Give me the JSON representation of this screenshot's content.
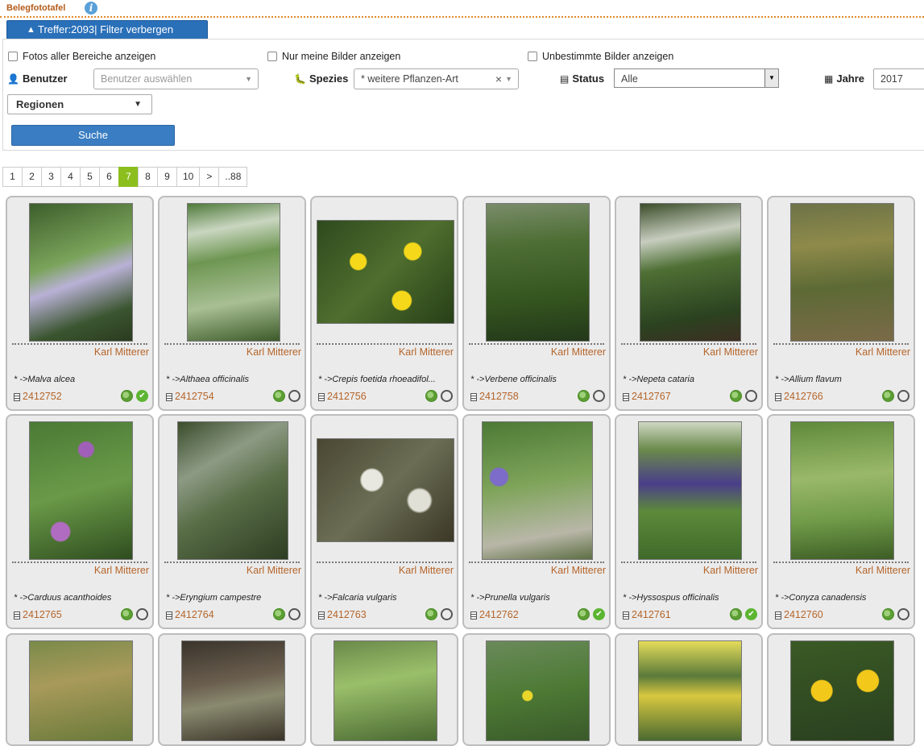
{
  "header": {
    "title": "Belegfototafel",
    "info_icon": "info-icon"
  },
  "filter_toggle": {
    "label": "Treffer:2093| Filter verbergen"
  },
  "filters": {
    "checkbox_all_areas": "Fotos aller Bereiche anzeigen",
    "checkbox_my_images": "Nur meine Bilder anzeigen",
    "checkbox_undetermined": "Unbestimmte Bilder anzeigen",
    "user_label": "Benutzer",
    "user_placeholder": "Benutzer auswählen",
    "species_label": "Spezies",
    "species_value": "* weitere Pflanzen-Art",
    "status_label": "Status",
    "status_value": "Alle",
    "year_label": "Jahre",
    "year_value": "2017",
    "regions_label": "Regionen",
    "search_button": "Suche"
  },
  "pager": {
    "pages": [
      "1",
      "2",
      "3",
      "4",
      "5",
      "6",
      "7",
      "8",
      "9",
      "10",
      ">",
      "..88"
    ],
    "active": "7"
  },
  "cards": [
    {
      "author": "Karl Mitterer",
      "species": "* ->Malva alcea",
      "id": "2412752",
      "verified": true
    },
    {
      "author": "Karl Mitterer",
      "species": "* ->Althaea officinalis",
      "id": "2412754",
      "verified": false
    },
    {
      "author": "Karl Mitterer",
      "species": "* ->Crepis foetida rhoeadifol...",
      "id": "2412756",
      "verified": false
    },
    {
      "author": "Karl Mitterer",
      "species": "* ->Verbene officinalis",
      "id": "2412758",
      "verified": false
    },
    {
      "author": "Karl Mitterer",
      "species": "* ->Nepeta cataria",
      "id": "2412767",
      "verified": false
    },
    {
      "author": "Karl Mitterer",
      "species": "* ->Allium flavum",
      "id": "2412766",
      "verified": false
    },
    {
      "author": "Karl Mitterer",
      "species": "* ->Carduus acanthoides",
      "id": "2412765",
      "verified": false
    },
    {
      "author": "Karl Mitterer",
      "species": "* ->Eryngium campestre",
      "id": "2412764",
      "verified": false
    },
    {
      "author": "Karl Mitterer",
      "species": "* ->Falcaria vulgaris",
      "id": "2412763",
      "verified": false
    },
    {
      "author": "Karl Mitterer",
      "species": "* ->Prunella vulgaris",
      "id": "2412762",
      "verified": true
    },
    {
      "author": "Karl Mitterer",
      "species": "* ->Hyssospus officinalis",
      "id": "2412761",
      "verified": true
    },
    {
      "author": "Karl Mitterer",
      "species": "* ->Conyza canadensis",
      "id": "2412760",
      "verified": false
    },
    {
      "author": "",
      "species": "",
      "id": "",
      "verified": false
    },
    {
      "author": "",
      "species": "",
      "id": "",
      "verified": false
    },
    {
      "author": "",
      "species": "",
      "id": "",
      "verified": false
    },
    {
      "author": "",
      "species": "",
      "id": "",
      "verified": false
    },
    {
      "author": "",
      "species": "",
      "id": "",
      "verified": false
    },
    {
      "author": "",
      "species": "",
      "id": "",
      "verified": false
    }
  ],
  "colors": {
    "accent_blue": "#2a70b9",
    "pager_active": "#8cbf1e",
    "author_text": "#b5652a",
    "verified_green": "#5cb531"
  }
}
